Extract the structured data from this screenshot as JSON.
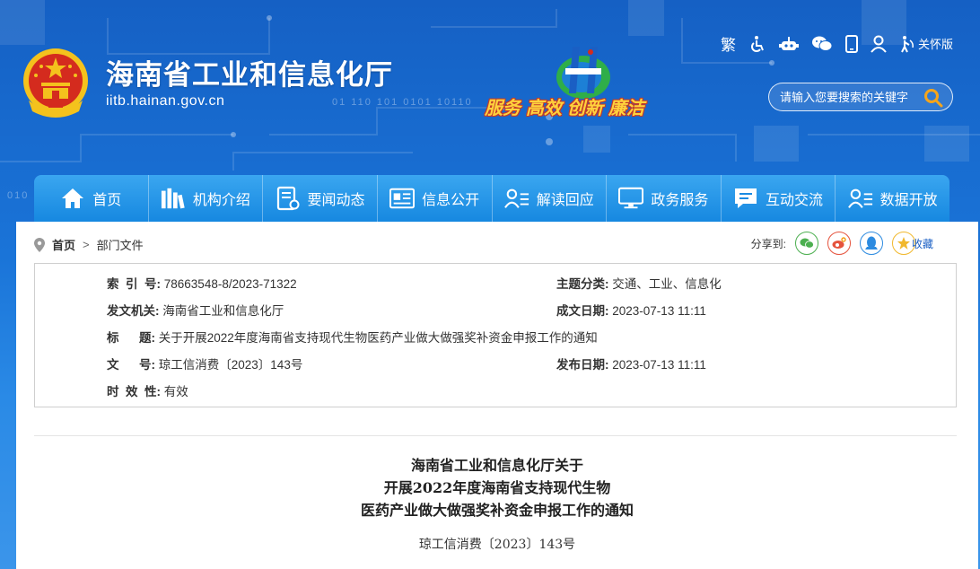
{
  "header": {
    "site_title": "海南省工业和信息化厅",
    "site_url": "iitb.hainan.gov.cn",
    "slogan": [
      "服务",
      "高效",
      "创新",
      "廉洁"
    ],
    "binary_1": "01 110 101 0101 10110",
    "binary_2": "010"
  },
  "topbar": {
    "traditional_label": "繁",
    "elder_mode_label": "关怀版",
    "icons": [
      "accessibility-icon",
      "robot-icon",
      "wechat-icon",
      "mobile-icon",
      "user-icon",
      "elder-care-icon"
    ]
  },
  "search": {
    "placeholder": "请输入您要搜索的关键字"
  },
  "nav": [
    {
      "label": "首页",
      "icon": "home-icon"
    },
    {
      "label": "机构介绍",
      "icon": "books-icon"
    },
    {
      "label": "要闻动态",
      "icon": "news-icon"
    },
    {
      "label": "信息公开",
      "icon": "info-icon"
    },
    {
      "label": "解读回应",
      "icon": "interpret-icon"
    },
    {
      "label": "政务服务",
      "icon": "service-icon"
    },
    {
      "label": "互动交流",
      "icon": "chat-icon"
    },
    {
      "label": "数据开放",
      "icon": "data-icon"
    }
  ],
  "breadcrumb": {
    "home": "首页",
    "separator": ">",
    "current": "部门文件"
  },
  "share": {
    "label": "分享到:",
    "favorite": "收藏"
  },
  "meta": {
    "index_label": "索  引  号:",
    "index_value": "78663548-8/2023-71322",
    "topic_label": "主题分类:",
    "topic_value": "交通、工业、信息化",
    "issuer_label": "发文机关:",
    "issuer_value": "海南省工业和信息化厅",
    "written_label": "成文日期:",
    "written_value": "2023-07-13 11:11",
    "title_label": "标      题:",
    "title_value": "关于开展2022年度海南省支持现代生物医药产业做大做强奖补资金申报工作的通知",
    "docno_label": "文      号:",
    "docno_value": "琼工信消费〔2023〕143号",
    "publish_label": "发布日期:",
    "publish_value": "2023-07-13 11:11",
    "validity_label": "时  效  性:",
    "validity_value": "有效"
  },
  "document": {
    "title_line1": "海南省工业和信息化厅关于",
    "title_line2": "开展2022年度海南省支持现代生物",
    "title_line3": "医药产业做大做强奖补资金申报工作的通知",
    "doc_number": "琼工信消费〔2023〕143号"
  },
  "colors": {
    "header_blue": "#1565c9",
    "nav_blue": "#1688e0",
    "slogan_yellow": "#ffd23c",
    "accent_red": "#c0392b"
  }
}
